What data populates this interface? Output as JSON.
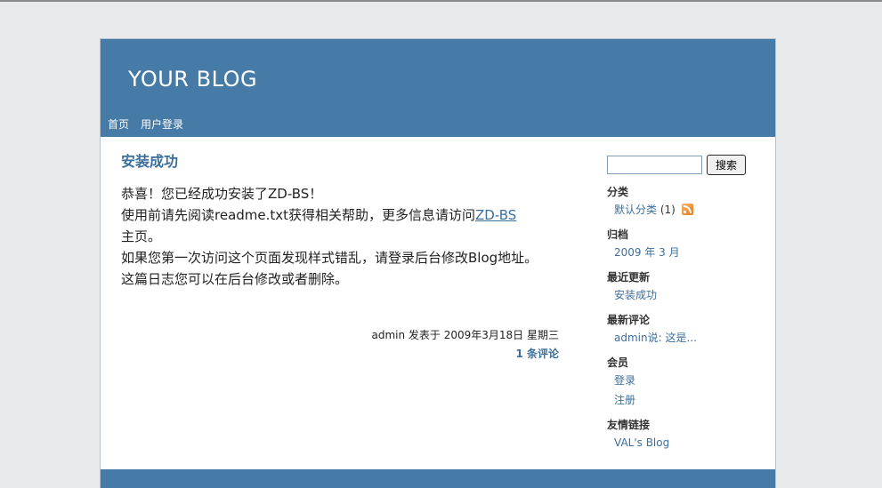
{
  "header": {
    "title": "YOUR BLOG",
    "nav": [
      {
        "label": "首页"
      },
      {
        "label": "用户登录"
      }
    ]
  },
  "post": {
    "title": "安装成功",
    "line1": "恭喜！您已经成功安装了ZD-BS！",
    "line2_prefix": "使用前请先阅读readme.txt获得相关帮助，更多信息请访问",
    "line2_link": "ZD-BS",
    "line2_suffix": "主页。",
    "line3": "如果您第一次访问这个页面发现样式错乱，请登录后台修改Blog地址。",
    "line4": "这篇日志您可以在后台修改或者删除。",
    "meta": "admin 发表于 2009年3月18日 星期三",
    "comments": "1 条评论"
  },
  "sidebar": {
    "search_button": "搜索",
    "search_value": "",
    "categories": {
      "title": "分类",
      "item": "默认分类",
      "count": "(1)"
    },
    "archives": {
      "title": "归档",
      "item": "2009 年 3 月"
    },
    "recent_posts": {
      "title": "最近更新",
      "item": "安装成功"
    },
    "recent_comments": {
      "title": "最新评论",
      "item": "admin说: 这是..."
    },
    "members": {
      "title": "会员",
      "login": "登录",
      "register": "注册"
    },
    "links": {
      "title": "友情链接",
      "item": "VAL's Blog"
    }
  },
  "colors": {
    "header_bg": "#467ba8",
    "link": "#3d6f9b",
    "page_bg": "#e9eaeb"
  }
}
